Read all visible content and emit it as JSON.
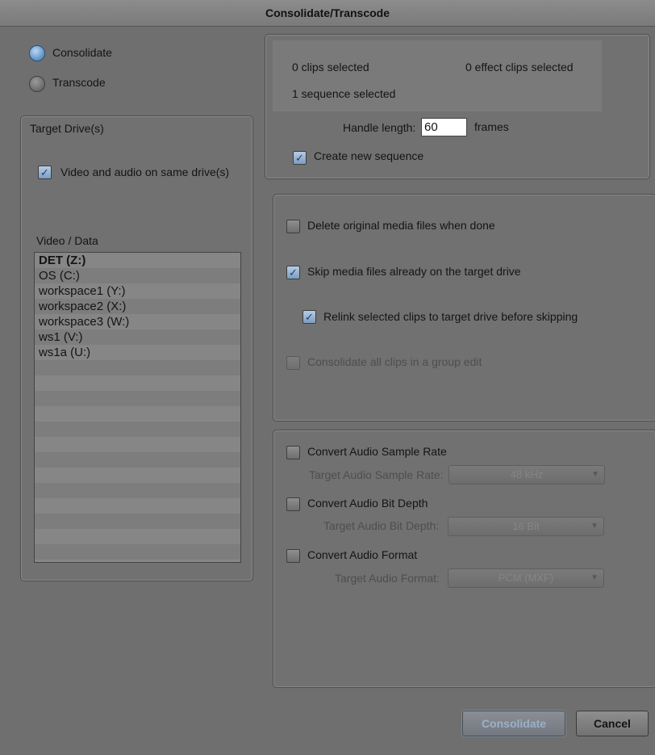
{
  "window": {
    "title": "Consolidate/Transcode"
  },
  "mode": {
    "consolidate_label": "Consolidate",
    "transcode_label": "Transcode",
    "selected": "Consolidate"
  },
  "target_drives": {
    "title": "Target Drive(s)",
    "same_drive_label": "Video and audio on same drive(s)",
    "same_drive_checked": true,
    "list_header": "Video / Data",
    "drives": [
      "DET (Z:)",
      "OS (C:)",
      "workspace1 (Y:)",
      "workspace2 (X:)",
      "workspace3 (W:)",
      "ws1 (V:)",
      "ws1a (U:)"
    ],
    "selected_drive": "DET (Z:)"
  },
  "selection": {
    "clips_selected": "0 clips selected",
    "effect_clips_selected": "0 effect clips selected",
    "sequences_selected": "1 sequence selected"
  },
  "handle": {
    "label": "Handle length:",
    "value": "60",
    "unit": "frames"
  },
  "create_sequence": {
    "label": "Create new sequence",
    "checked": true
  },
  "options": {
    "delete_original": {
      "label": "Delete original media files when done",
      "checked": false
    },
    "skip_existing": {
      "label": "Skip media files already on the target drive",
      "checked": true
    },
    "relink": {
      "label": "Relink selected clips to target drive before skipping",
      "checked": true
    },
    "group_edit": {
      "label": "Consolidate all clips in a group edit",
      "checked": false,
      "disabled": true
    }
  },
  "audio": {
    "sample_rate": {
      "label": "Convert Audio Sample Rate",
      "target_label": "Target Audio Sample Rate:",
      "value": "48 kHz"
    },
    "bit_depth": {
      "label": "Convert Audio Bit Depth",
      "target_label": "Target Audio Bit Depth:",
      "value": "16 Bit"
    },
    "format": {
      "label": "Convert Audio Format",
      "target_label": "Target Audio Format:",
      "value": "PCM (MXF)"
    }
  },
  "buttons": {
    "consolidate": "Consolidate",
    "cancel": "Cancel"
  },
  "colors": {
    "accent": "#5f8fc4",
    "background": "#6f6f6f"
  }
}
